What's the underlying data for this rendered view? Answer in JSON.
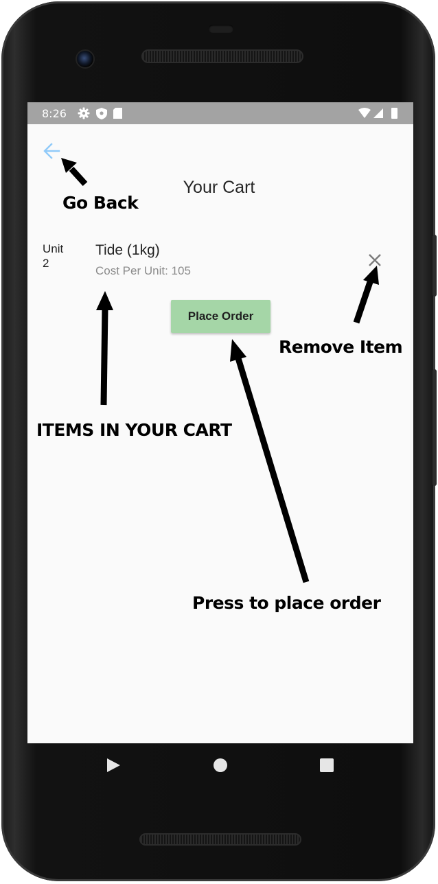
{
  "status_bar": {
    "time": "8:26",
    "icons": [
      "settings-icon",
      "shield-icon",
      "sd-card-icon",
      "wifi-icon",
      "signal-icon",
      "battery-icon"
    ]
  },
  "header": {
    "title": "Your Cart",
    "back_icon": "arrow-left-icon"
  },
  "cart": {
    "items": [
      {
        "unit_label": "Unit",
        "quantity": "2",
        "name": "Tide (1kg)",
        "cost": "Cost Per Unit: 105",
        "remove_icon": "close-icon"
      }
    ]
  },
  "actions": {
    "place_order_label": "Place Order"
  },
  "annotations": {
    "go_back": "Go Back",
    "items_in_cart": "ITEMS IN YOUR CART",
    "remove_item": "Remove Item",
    "press_to_place": "Press to place order"
  },
  "nav_bar": {
    "icons": [
      "back-triangle-icon",
      "home-circle-icon",
      "recents-square-icon"
    ]
  },
  "colors": {
    "accent_back": "#90caf9",
    "button_green": "#a5d6a7",
    "status_bar": "#a3a3a3",
    "screen_bg": "#fafafa"
  }
}
